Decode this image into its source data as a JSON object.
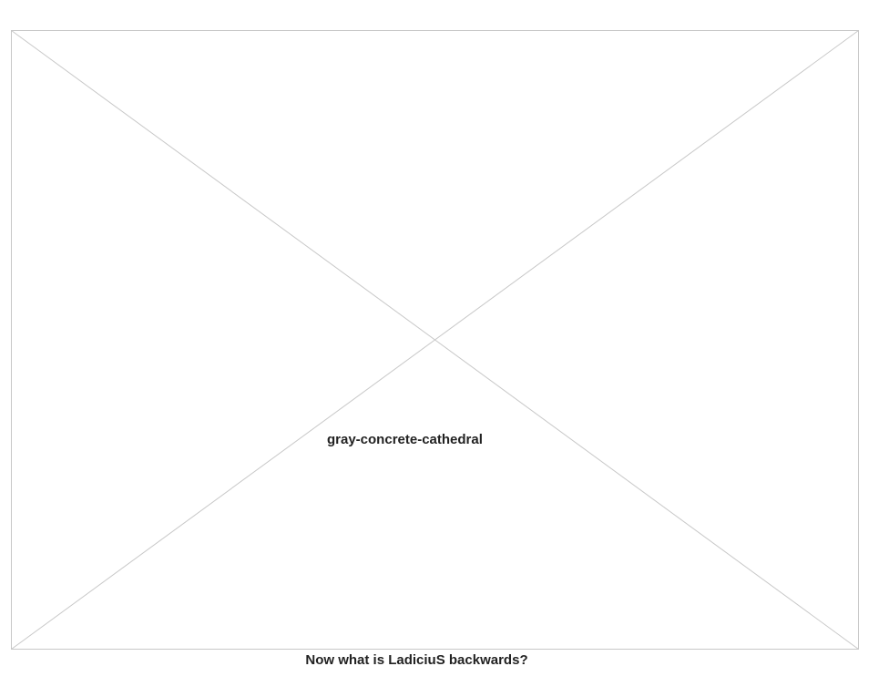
{
  "placeholder": {
    "label": "gray-concrete-cathedral",
    "stroke_color": "#c8c8c8"
  },
  "prompt": {
    "question": "Now what is LadiciuS backwards?"
  }
}
